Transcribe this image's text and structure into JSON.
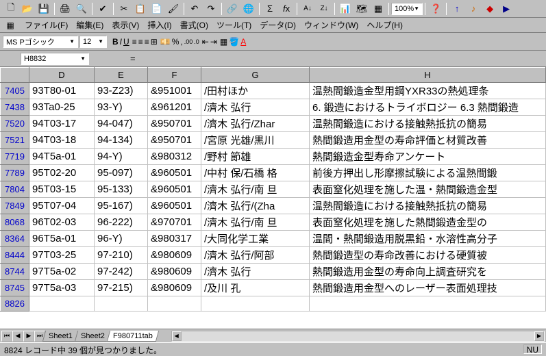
{
  "toolbar": {
    "zoom": "100%"
  },
  "menu": {
    "file": "ファイル(F)",
    "edit": "編集(E)",
    "view": "表示(V)",
    "insert": "挿入(I)",
    "format": "書式(O)",
    "tools": "ツール(T)",
    "data": "データ(D)",
    "window": "ウィンドウ(W)",
    "help": "ヘルプ(H)"
  },
  "format": {
    "font": "MS Pゴシック",
    "size": "12"
  },
  "formula": {
    "cell": "H8832",
    "value": "="
  },
  "columns": [
    "D",
    "E",
    "F",
    "G",
    "H"
  ],
  "rows": [
    {
      "n": "7405",
      "d": "93T80-01",
      "e": "93-Z23)",
      "f": "&951001",
      "g": "/田村ほか",
      "h": "温熱間鍛造金型用鋼YXR33の熱処理条"
    },
    {
      "n": "7438",
      "d": "93Ta0-25",
      "e": "93-Y)",
      "f": "&961201",
      "g": "/濟木 弘行",
      "h": "6. 鍛造におけるトライボロジー 6.3 熱間鍛造"
    },
    {
      "n": "7520",
      "d": "94T03-17",
      "e": "94-047)",
      "f": "&950701",
      "g": "/濟木 弘行/Zhar",
      "h": "温熱間鍛造における接触熱抵抗の簡易"
    },
    {
      "n": "7521",
      "d": "94T03-18",
      "e": "94-134)",
      "f": "&950701",
      "g": "/宮原 光雄/黒川",
      "h": "熱間鍛造用金型の寿命評価と材質改善"
    },
    {
      "n": "7719",
      "d": "94T5a-01",
      "e": "94-Y)",
      "f": "&980312",
      "g": "/野村 節雄",
      "h": "熱間鍛造金型寿命アンケート"
    },
    {
      "n": "7789",
      "d": "95T02-20",
      "e": "95-097)",
      "f": "&960501",
      "g": "/中村 保/石橋 格",
      "h": "前後方押出し形摩擦試験による温熱間鍛"
    },
    {
      "n": "7804",
      "d": "95T03-15",
      "e": "95-133)",
      "f": "&960501",
      "g": "/濟木 弘行/南 旦",
      "h": "表面窒化処理を施した温・熱間鍛造金型"
    },
    {
      "n": "7849",
      "d": "95T07-04",
      "e": "95-167)",
      "f": "&960501",
      "g": "/濟木 弘行/(Zha",
      "h": "温熱間鍛造における接触熱抵抗の簡易"
    },
    {
      "n": "8068",
      "d": "96T02-03",
      "e": "96-222)",
      "f": "&970701",
      "g": "/濟木 弘行/南 旦",
      "h": "表面窒化処理を施した熱間鍛造金型の"
    },
    {
      "n": "8364",
      "d": "96T5a-01",
      "e": "96-Y)",
      "f": "&980317",
      "g": "/大同化学工業",
      "h": "温間・熱間鍛造用脱黒鉛・水溶性高分子"
    },
    {
      "n": "8444",
      "d": "97T03-25",
      "e": "97-210)",
      "f": "&980609",
      "g": "/濟木 弘行/阿部",
      "h": "熱間鍛造型の寿命改善における硬質被"
    },
    {
      "n": "8744",
      "d": "97T5a-02",
      "e": "97-242)",
      "f": "&980609",
      "g": "/濟木 弘行",
      "h": "熱間鍛造用金型の寿命向上調査研究を"
    },
    {
      "n": "8745",
      "d": "97T5a-03",
      "e": "97-215)",
      "f": "&980609",
      "g": "/及川 孔",
      "h": "熱間鍛造用金型へのレーザー表面処理技"
    }
  ],
  "emptyrow": "8826",
  "tabs": {
    "s1": "Sheet1",
    "s2": "Sheet2",
    "s3": "F980711tab"
  },
  "status": {
    "text": "8824 レコード中 39 個が見つかりました。",
    "right": "NU"
  }
}
